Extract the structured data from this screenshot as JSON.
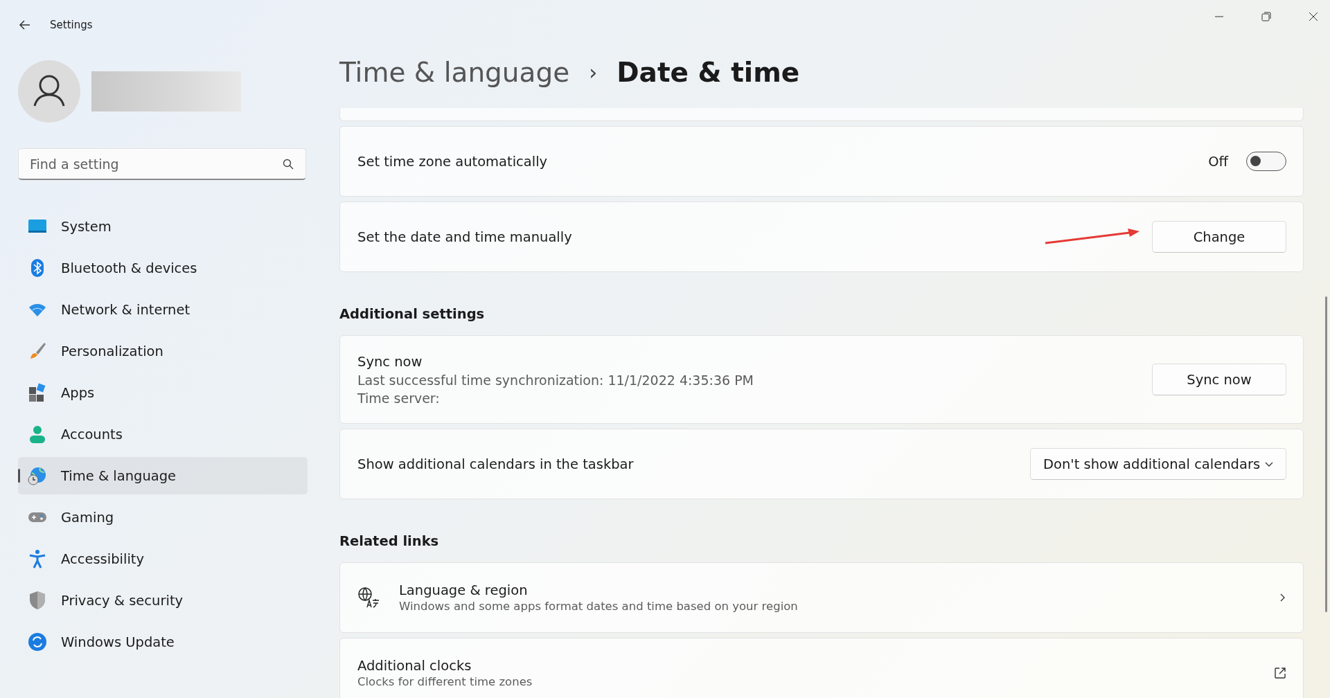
{
  "window": {
    "title": "Settings"
  },
  "search": {
    "placeholder": "Find a setting"
  },
  "nav": [
    {
      "label": "System",
      "kind": "system",
      "selected": false
    },
    {
      "label": "Bluetooth & devices",
      "kind": "bluetooth",
      "selected": false
    },
    {
      "label": "Network & internet",
      "kind": "wifi",
      "selected": false
    },
    {
      "label": "Personalization",
      "kind": "brush",
      "selected": false
    },
    {
      "label": "Apps",
      "kind": "apps",
      "selected": false
    },
    {
      "label": "Accounts",
      "kind": "person",
      "selected": false
    },
    {
      "label": "Time & language",
      "kind": "globe",
      "selected": true
    },
    {
      "label": "Gaming",
      "kind": "gamepad",
      "selected": false
    },
    {
      "label": "Accessibility",
      "kind": "access",
      "selected": false
    },
    {
      "label": "Privacy & security",
      "kind": "shield",
      "selected": false
    },
    {
      "label": "Windows Update",
      "kind": "update",
      "selected": false
    }
  ],
  "breadcrumb": {
    "parent": "Time & language",
    "separator": "›",
    "current": "Date & time"
  },
  "sections": [
    {
      "cards": [
        {
          "kind": "toggle",
          "title": "Set time zone automatically",
          "state_label": "Off",
          "on": false
        },
        {
          "kind": "button",
          "title": "Set the date and time manually",
          "button": "Change",
          "annotated": true
        }
      ]
    },
    {
      "heading": "Additional settings",
      "cards": [
        {
          "kind": "button",
          "title": "Sync now",
          "lines": [
            "Last successful time synchronization: 11/1/2022 4:35:36 PM",
            "Time server:"
          ],
          "button": "Sync now",
          "annotated": false
        },
        {
          "kind": "dropdown",
          "title": "Show additional calendars in the taskbar",
          "value": "Don't show additional calendars"
        }
      ]
    },
    {
      "heading": "Related links",
      "cards": [
        {
          "kind": "link",
          "title": "Language & region",
          "subtitle": "Windows and some apps format dates and time based on your region"
        },
        {
          "kind": "external",
          "title": "Additional clocks",
          "subtitle": "Clocks for different time zones"
        }
      ]
    }
  ]
}
